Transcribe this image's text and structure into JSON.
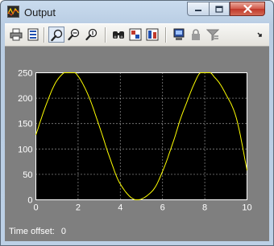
{
  "window": {
    "title": "Output"
  },
  "toolbar": {
    "icons": [
      "print-icon",
      "parameters-icon",
      "zoom-icon",
      "zoom-x-icon",
      "zoom-y-icon",
      "autoscale-icon",
      "save-axes-icon",
      "restore-axes-icon",
      "floating-scope-icon",
      "lock-icon",
      "signal-selection-icon",
      "overflow-icon"
    ],
    "pressed": "zoom-icon"
  },
  "status": {
    "label": "Time offset:",
    "value": "0"
  },
  "chart_data": {
    "type": "line",
    "title": "",
    "xlabel": "",
    "ylabel": "",
    "xlim": [
      0,
      10
    ],
    "ylim": [
      0,
      250
    ],
    "xticks": [
      "0",
      "2",
      "4",
      "6",
      "8",
      "10"
    ],
    "yticks": [
      "0",
      "50",
      "100",
      "150",
      "200",
      "250"
    ],
    "grid": true,
    "background": "#000000",
    "line_color": "#ffff00",
    "series": [
      {
        "x": [
          0,
          0.5,
          1,
          1.571,
          2,
          2.5,
          3,
          3.5,
          4,
          4.712,
          5.5,
          6,
          6.5,
          7,
          7.854,
          8.5,
          9,
          9.5,
          10
        ],
        "values": [
          127.5,
          188.6,
          234.8,
          255.0,
          243.4,
          203.8,
          145.5,
          82.8,
          31.0,
          0.0,
          16.6,
          55.9,
          113.3,
          176.3,
          255.0,
          239.5,
          207.7,
          160.3,
          58.1
        ]
      }
    ]
  }
}
